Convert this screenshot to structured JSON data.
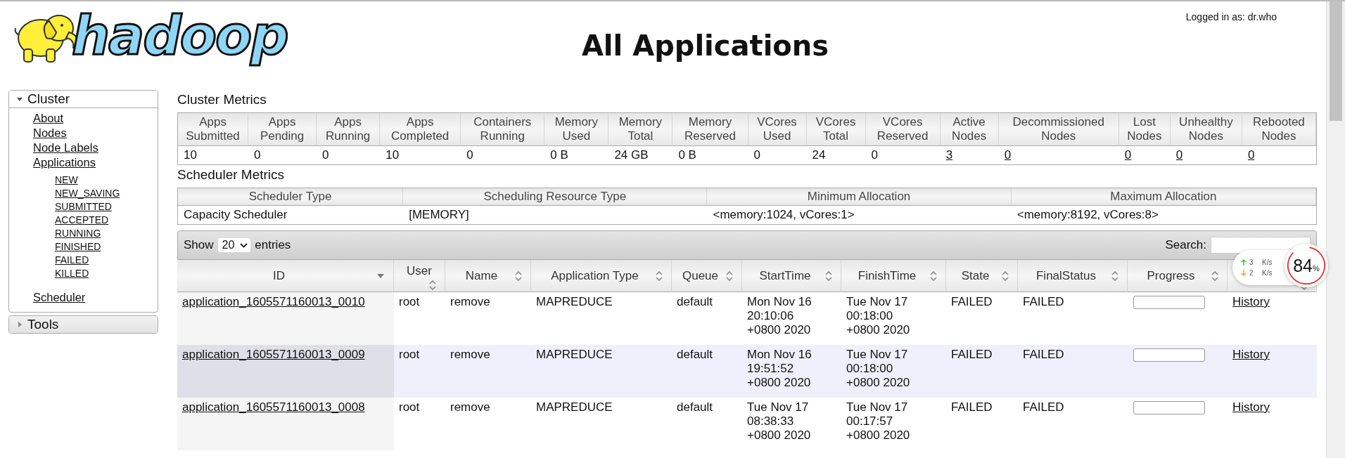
{
  "logo": {
    "text": "hadoop"
  },
  "title": "All Applications",
  "login": "Logged in as: dr.who",
  "sidebar": {
    "sections": [
      {
        "label": "Cluster",
        "expanded": true,
        "items": [
          {
            "label": "About"
          },
          {
            "label": "Nodes"
          },
          {
            "label": "Node Labels"
          },
          {
            "label": "Applications",
            "children": [
              {
                "label": "NEW"
              },
              {
                "label": "NEW_SAVING"
              },
              {
                "label": "SUBMITTED"
              },
              {
                "label": "ACCEPTED"
              },
              {
                "label": "RUNNING"
              },
              {
                "label": "FINISHED"
              },
              {
                "label": "FAILED"
              },
              {
                "label": "KILLED"
              }
            ]
          },
          {
            "label": "Scheduler"
          }
        ]
      },
      {
        "label": "Tools",
        "expanded": false
      }
    ]
  },
  "cluster_metrics": {
    "title": "Cluster Metrics",
    "columns": [
      {
        "label": "Apps Submitted",
        "value": "10",
        "link": false
      },
      {
        "label": "Apps Pending",
        "value": "0",
        "link": false
      },
      {
        "label": "Apps Running",
        "value": "0",
        "link": false
      },
      {
        "label": "Apps Completed",
        "value": "10",
        "link": false
      },
      {
        "label": "Containers Running",
        "value": "0",
        "link": false
      },
      {
        "label": "Memory Used",
        "value": "0 B",
        "link": false
      },
      {
        "label": "Memory Total",
        "value": "24 GB",
        "link": false
      },
      {
        "label": "Memory Reserved",
        "value": "0 B",
        "link": false
      },
      {
        "label": "VCores Used",
        "value": "0",
        "link": false
      },
      {
        "label": "VCores Total",
        "value": "24",
        "link": false
      },
      {
        "label": "VCores Reserved",
        "value": "0",
        "link": false
      },
      {
        "label": "Active Nodes",
        "value": "3",
        "link": true
      },
      {
        "label": "Decommissioned Nodes",
        "value": "0",
        "link": true
      },
      {
        "label": "Lost Nodes",
        "value": "0",
        "link": true
      },
      {
        "label": "Unhealthy Nodes",
        "value": "0",
        "link": true
      },
      {
        "label": "Rebooted Nodes",
        "value": "0",
        "link": true
      }
    ]
  },
  "scheduler_metrics": {
    "title": "Scheduler Metrics",
    "columns": [
      {
        "label": "Scheduler Type",
        "value": "Capacity Scheduler"
      },
      {
        "label": "Scheduling Resource Type",
        "value": "[MEMORY]"
      },
      {
        "label": "Minimum Allocation",
        "value": "<memory:1024, vCores:1>"
      },
      {
        "label": "Maximum Allocation",
        "value": "<memory:8192, vCores:8>"
      }
    ]
  },
  "applications": {
    "show_label": "Show",
    "page_size": "20",
    "entries_label": "entries",
    "search_label": "Search:",
    "columns": [
      {
        "label": "ID",
        "sorted": true
      },
      {
        "label": "User",
        "sorted": false
      },
      {
        "label": "Name",
        "sorted": false
      },
      {
        "label": "Application Type",
        "sorted": false
      },
      {
        "label": "Queue",
        "sorted": false
      },
      {
        "label": "StartTime",
        "sorted": false
      },
      {
        "label": "FinishTime",
        "sorted": false
      },
      {
        "label": "State",
        "sorted": false
      },
      {
        "label": "FinalStatus",
        "sorted": false
      },
      {
        "label": "Progress",
        "sorted": false
      },
      {
        "sorted": false
      }
    ],
    "rows": [
      {
        "id": "application_1605571160013_0010",
        "user": "root",
        "name": "remove",
        "type": "MAPREDUCE",
        "queue": "default",
        "start": "Mon Nov 16 20:10:06 +0800 2020",
        "finish": "Tue Nov 17 00:18:00 +0800 2020",
        "state": "FAILED",
        "final_status": "FAILED",
        "level": 0,
        "link": "History"
      },
      {
        "id": "application_1605571160013_0009",
        "user": "root",
        "name": "remove",
        "type": "MAPREDUCE",
        "queue": "default",
        "start": "Mon Nov 16 19:51:52 +0800 2020",
        "finish": "Tue Nov 17 00:18:00 +0800 2020",
        "state": "FAILED",
        "final_status": "FAILED",
        "level": 0,
        "link": "History"
      },
      {
        "id": "application_1605571160013_0008",
        "user": "root",
        "name": "remove",
        "type": "MAPREDUCE",
        "queue": "default",
        "start": "Tue Nov 17 08:38:33 +0800 2020",
        "finish": "Tue Nov 17 00:17:57 +0800 2020",
        "state": "FAILED",
        "final_status": "FAILED",
        "level": 0,
        "link": "History"
      }
    ]
  },
  "net_widget": {
    "upload": "3",
    "upload_unit": "K/s",
    "download": "2",
    "download_unit": "K/s",
    "percent": "84",
    "percent_unit": "%"
  }
}
